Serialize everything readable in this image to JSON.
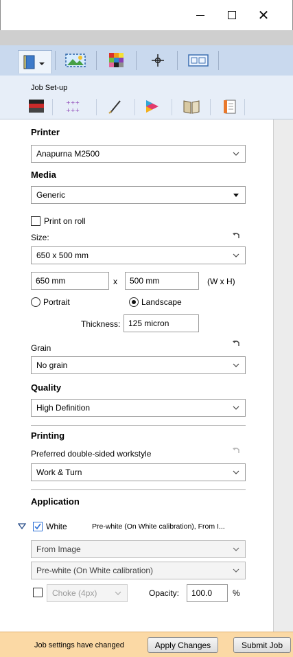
{
  "window": {
    "minimize_icon": "minimize-icon",
    "maximize_icon": "maximize-icon",
    "close_icon": "close-icon"
  },
  "toolbar": {
    "icons": [
      "job-setup-icon",
      "image-placement-icon",
      "color-swatch-icon",
      "target-crosshair-icon",
      "layout-icon"
    ]
  },
  "section": {
    "title": "Job Set-up",
    "subtabs": [
      "printer-media-icon",
      "grid-marks-icon",
      "pen-icon",
      "color-triangle-icon",
      "book-icon",
      "document-icon"
    ]
  },
  "printer": {
    "heading": "Printer",
    "value": "Anapurna M2500"
  },
  "media": {
    "heading": "Media",
    "value": "Generic",
    "print_on_roll": "Print on roll",
    "size_label": "Size:",
    "size_value": "650 x 500 mm",
    "width": "650 mm",
    "x_label": "x",
    "height": "500 mm",
    "wh_label": "(W x H)",
    "portrait": "Portrait",
    "landscape": "Landscape",
    "orientation_selected": "Landscape",
    "thickness_label": "Thickness:",
    "thickness": "125 micron",
    "grain_label": "Grain",
    "grain_value": "No grain"
  },
  "quality": {
    "heading": "Quality",
    "value": "High Definition"
  },
  "printing": {
    "heading": "Printing",
    "workstyle_label": "Preferred double-sided workstyle",
    "workstyle_value": "Work & Turn"
  },
  "application": {
    "heading": "Application",
    "white_label": "White",
    "white_checked": true,
    "white_summary": "Pre-white (On White calibration), From I...",
    "source_value": "From Image",
    "mode_value": "Pre-white (On White calibration)",
    "choke_value": "Choke (4px)",
    "choke_checked": false,
    "opacity_label": "Opacity:",
    "opacity_value": "100.0",
    "percent": "%"
  },
  "status": {
    "message": "Job settings have changed",
    "apply_label": "Apply Changes",
    "submit_label": "Submit Job"
  },
  "colors": {
    "toolbar_bg": "#c9d9ee",
    "status_bg": "#fbd9a5",
    "check_blue": "#2b6fd6"
  }
}
